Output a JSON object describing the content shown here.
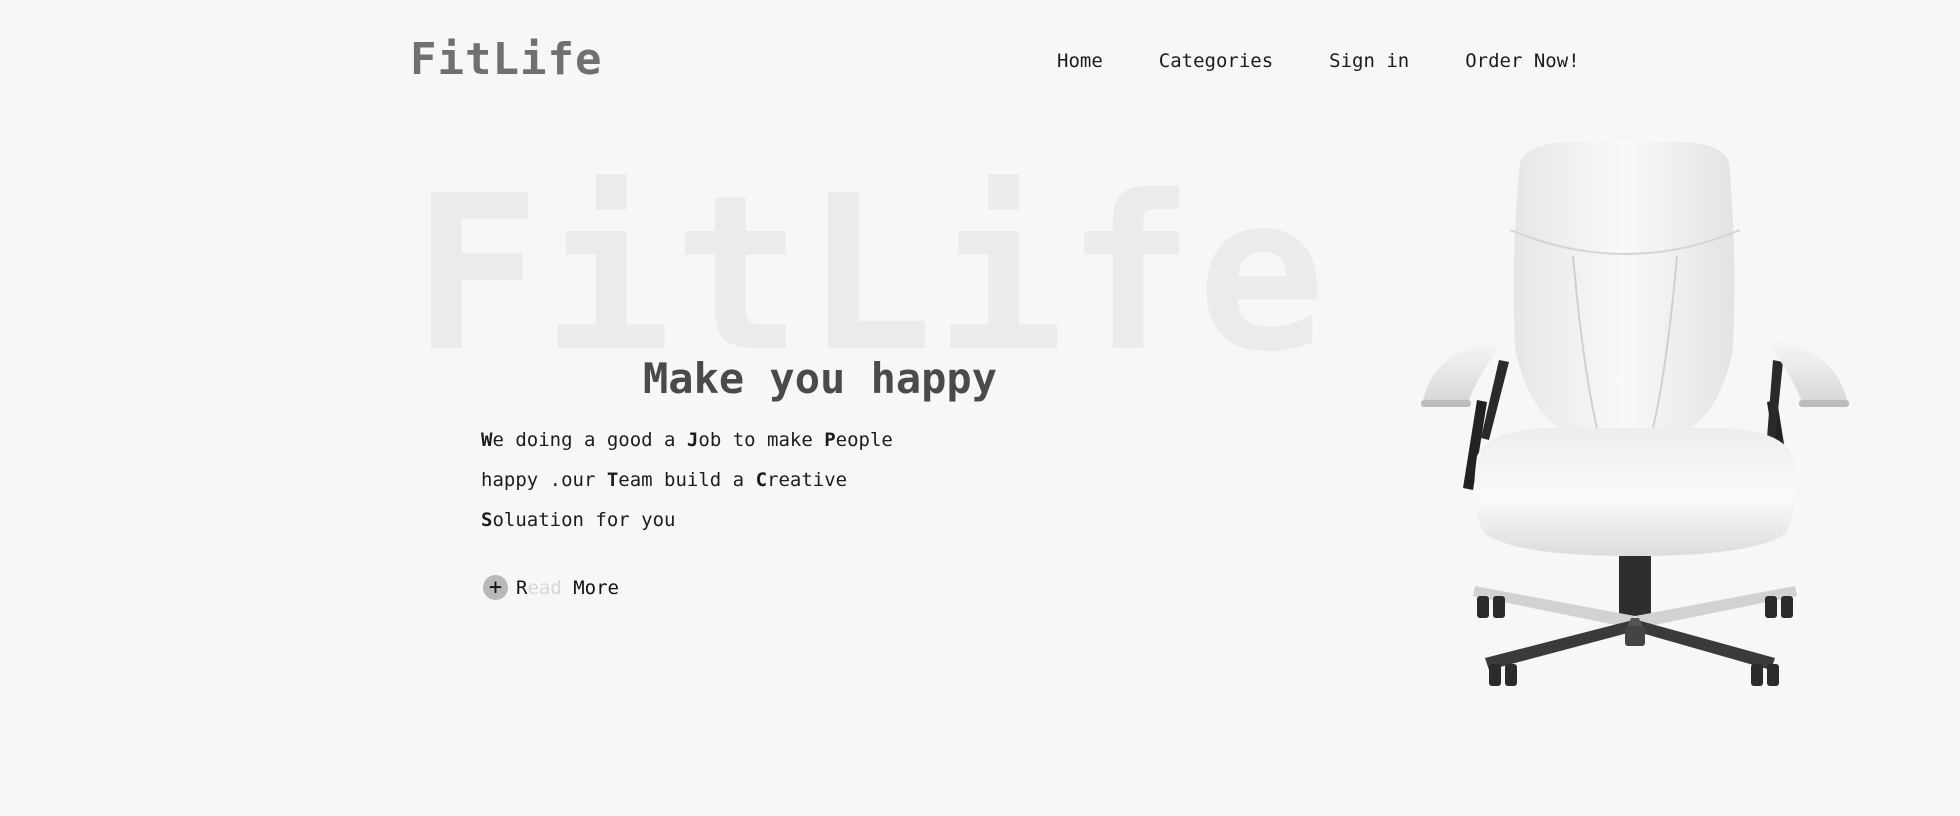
{
  "brand": {
    "name": "FitLife",
    "watermark": "FitLife"
  },
  "nav": {
    "items": [
      "Home",
      "Categories",
      "Sign in",
      "Order Now!"
    ]
  },
  "hero": {
    "headline": "Make you happy",
    "description": [
      {
        "bold": "W",
        "rest": "e doing a good a "
      },
      {
        "bold": "J",
        "rest": "ob to make "
      },
      {
        "bold": "P",
        "rest": "eople happy .our "
      },
      {
        "bold": "T",
        "rest": "eam build a "
      },
      {
        "bold": "C",
        "rest": "reative "
      },
      {
        "bold": "S",
        "rest": "oluation for you"
      }
    ],
    "cta": {
      "icon": "plus-icon",
      "glyph": "+",
      "part1": "R",
      "part2": "ead",
      "part3": " More"
    }
  },
  "image": {
    "subject": "chair-image"
  }
}
